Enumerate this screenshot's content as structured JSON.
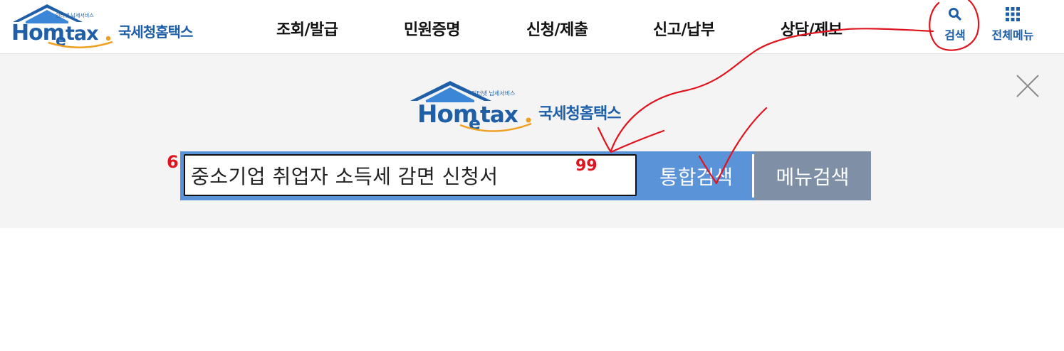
{
  "header": {
    "logo": {
      "tagline": "인터넷 납세서비스",
      "wordmark_home": "Hom",
      "wordmark_e": "e",
      "wordmark_tax": "tax",
      "korean_name": "국세청홈택스"
    },
    "nav": [
      "조회/발급",
      "민원증명",
      "신청/제출",
      "신고/납부",
      "상담/제보"
    ],
    "utility": {
      "search": {
        "label": "검색",
        "icon": "search-icon"
      },
      "all_menu": {
        "label": "전체메뉴",
        "icon": "grid-icon"
      }
    }
  },
  "search_panel": {
    "logo": {
      "tagline": "인터넷 납세서비스",
      "wordmark_home": "Hom",
      "wordmark_e": "e",
      "wordmark_tax": "tax",
      "korean_name": "국세청홈택스"
    },
    "query": "중소기업 취업자 소득세 감면 신청서",
    "integrated_search_label": "통합검색",
    "menu_search_label": "메뉴검색",
    "close_icon": "close-icon"
  },
  "annotations": {
    "mark_left": "6",
    "mark_right": "99"
  },
  "colors": {
    "brand_blue": "#1f5fa8",
    "search_blue": "#5b93d9",
    "menu_gray": "#7f8fa6",
    "panel_bg": "#f4f4f4",
    "annotation_red": "#e0141e",
    "logo_orange": "#f0a020"
  }
}
